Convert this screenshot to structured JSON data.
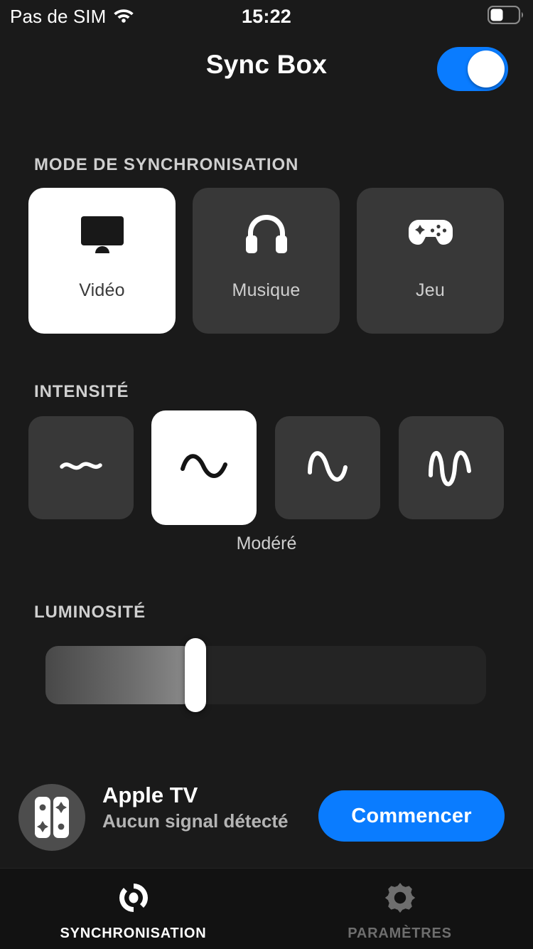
{
  "status_bar": {
    "carrier": "Pas de SIM",
    "wifi_icon": "wifi-icon",
    "time": "15:22",
    "battery_icon": "battery-icon"
  },
  "header": {
    "title": "Sync Box",
    "power_toggle": {
      "state": "on",
      "accent_color": "#0a7cff"
    }
  },
  "sync_mode": {
    "section_label": "MODE DE SYNCHRONISATION",
    "selected_index": 0,
    "cards": [
      {
        "label": "Vidéo",
        "icon": "tv-icon",
        "selected": true
      },
      {
        "label": "Musique",
        "icon": "headphones-icon",
        "selected": false
      },
      {
        "label": "Jeu",
        "icon": "gamepad-icon",
        "selected": false
      }
    ]
  },
  "intensity": {
    "section_label": "INTENSITÉ",
    "selected_index": 1,
    "selected_label": "Modéré",
    "cards": [
      {
        "icon": "wave-subtle-icon",
        "selected": false
      },
      {
        "icon": "wave-moderate-icon",
        "selected": true
      },
      {
        "icon": "wave-high-icon",
        "selected": false
      },
      {
        "icon": "wave-intense-icon",
        "selected": false
      }
    ]
  },
  "brightness": {
    "section_label": "LUMINOSITÉ",
    "value_percent": 34
  },
  "device": {
    "icon": "syncbox-device-icon",
    "name": "Apple TV",
    "status": "Aucun signal détecté",
    "start_label": "Commencer",
    "start_color": "#0a7cff"
  },
  "tabbar": {
    "tabs": [
      {
        "label": "SYNCHRONISATION",
        "icon": "sync-icon",
        "active": true
      },
      {
        "label": "PARAMÈTRES",
        "icon": "gear-icon",
        "active": false
      }
    ]
  }
}
